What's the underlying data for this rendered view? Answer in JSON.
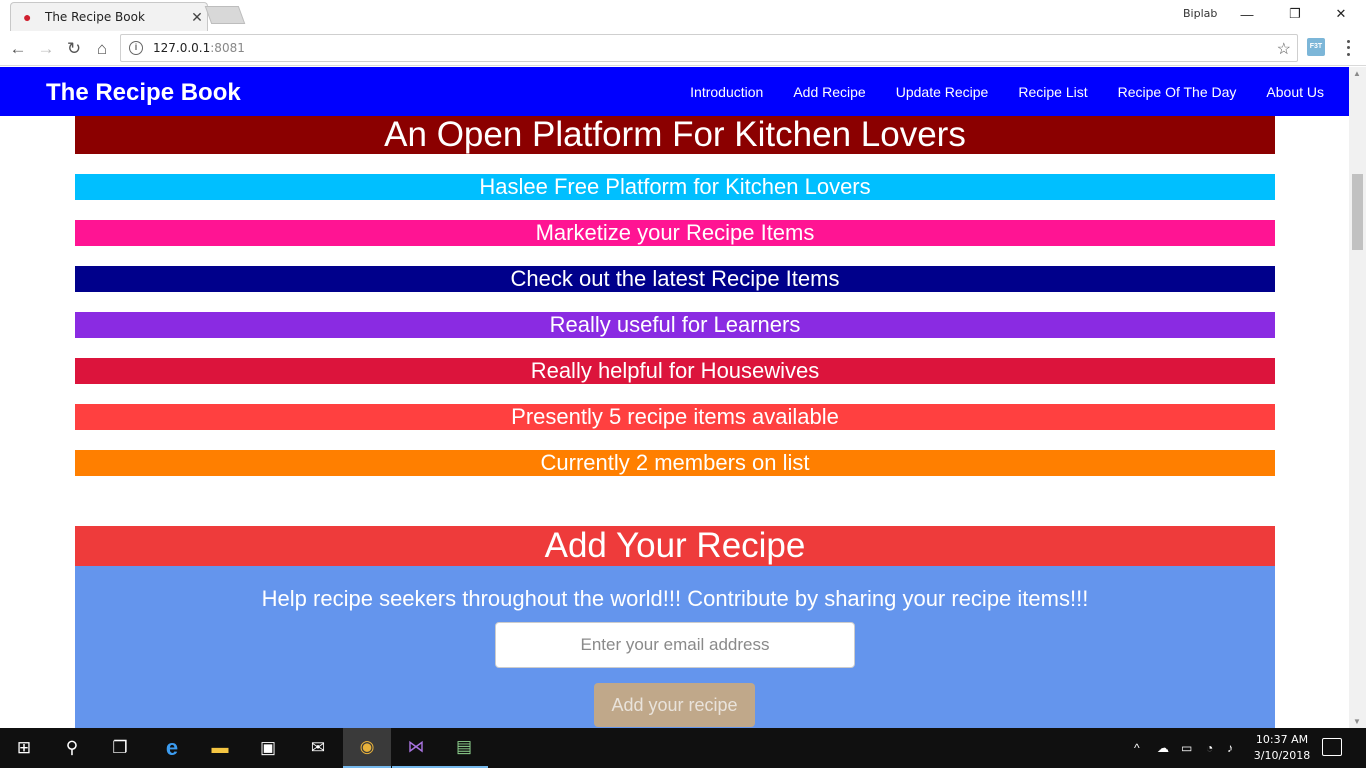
{
  "browser": {
    "tab_title": "The Recipe Book",
    "tab_close": "✕",
    "profile_name": "Biplab",
    "url_host": "127.0.0.1",
    "url_port": ":8081",
    "controls": {
      "minimize": "—",
      "restore": "❐",
      "close": "✕"
    },
    "ext_label": "F3T"
  },
  "navbar": {
    "brand": "The Recipe Book",
    "links": [
      "Introduction",
      "Add Recipe",
      "Update Recipe",
      "Recipe List",
      "Recipe Of The Day",
      "About Us"
    ],
    "color": "#0000ff"
  },
  "intro": {
    "banner": "An Open Platform For Kitchen Lovers",
    "features": [
      {
        "text": "Haslee Free Platform for Kitchen Lovers",
        "color": "#00bfff"
      },
      {
        "text": "Marketize your Recipe Items",
        "color": "#ff1493"
      },
      {
        "text": "Check out the latest Recipe Items",
        "color": "#00008b"
      },
      {
        "text": "Really useful for Learners",
        "color": "#8a2be2"
      },
      {
        "text": "Really helpful for Housewives",
        "color": "#dc143c"
      },
      {
        "text": "Presently 5 recipe items available",
        "color": "#ff4040"
      },
      {
        "text": "Currently 2 members on list",
        "color": "#ff7f00"
      }
    ]
  },
  "add_recipe": {
    "title": "Add Your Recipe",
    "text": "Help recipe seekers throughout the world!!! Contribute by sharing your recipe items!!!",
    "email_placeholder": "Enter your email address",
    "button": "Add your recipe"
  },
  "taskbar": {
    "time": "10:37 AM",
    "date": "3/10/2018"
  }
}
